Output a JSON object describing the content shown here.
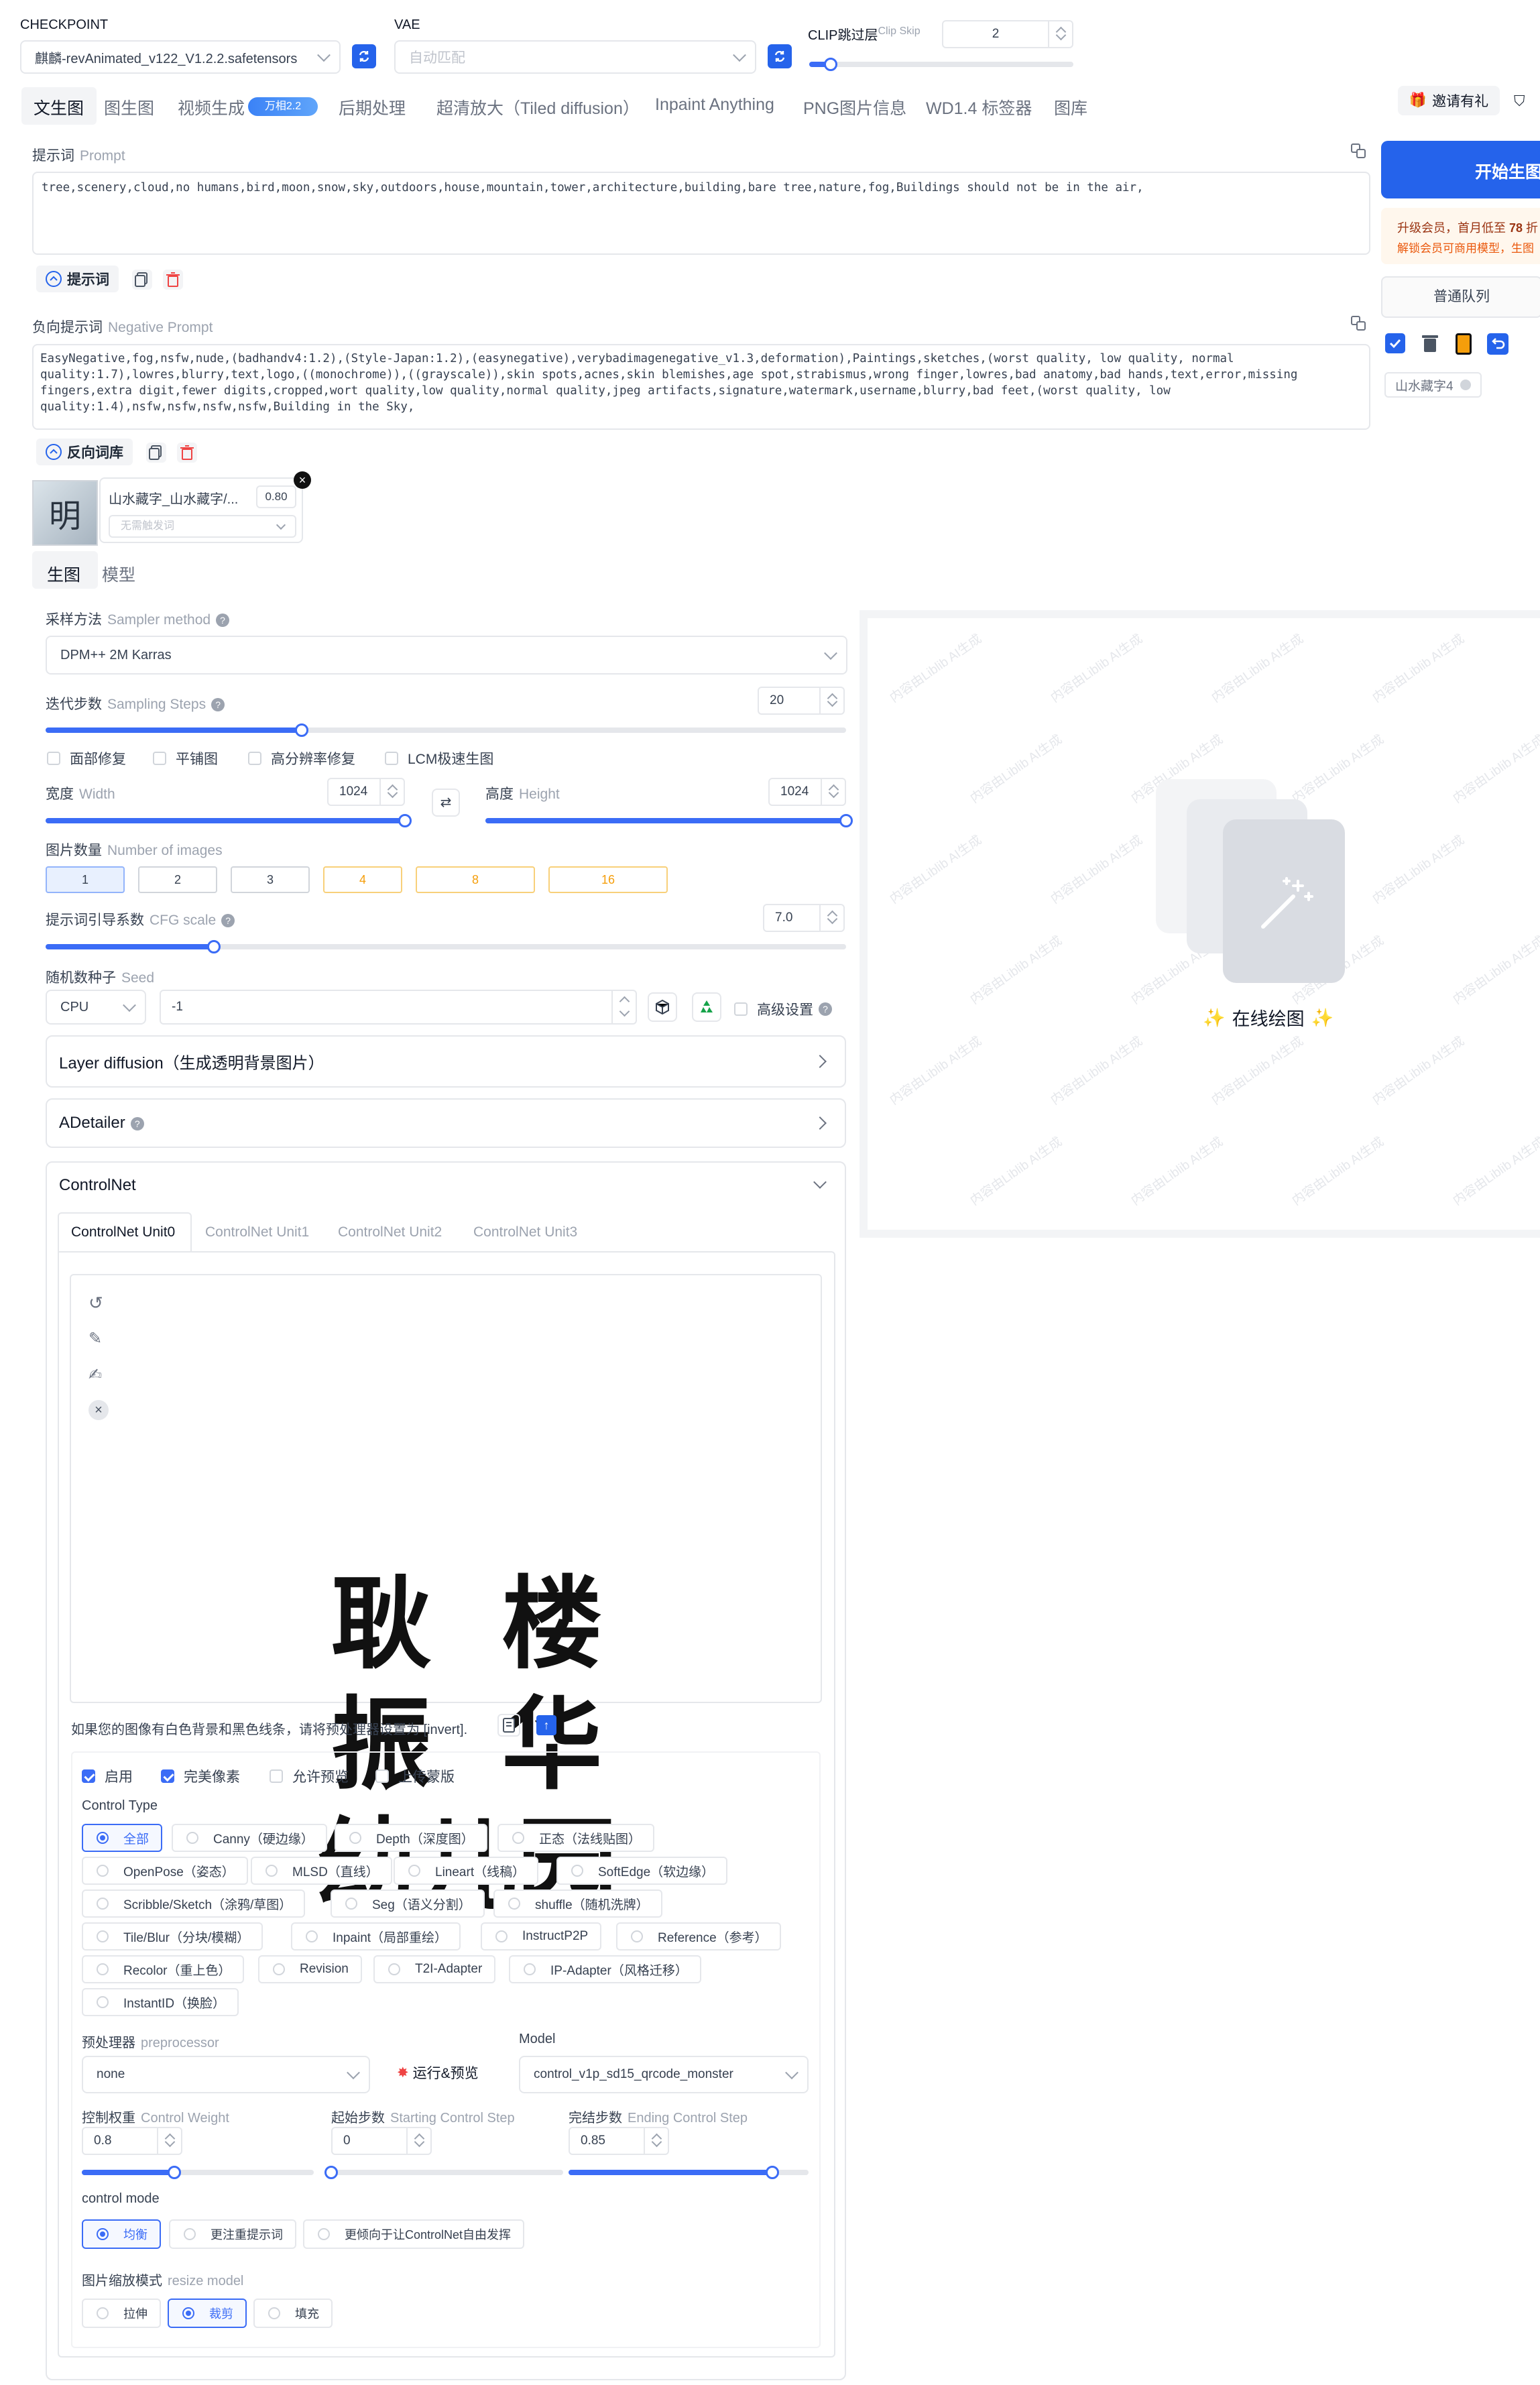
{
  "checkpoint": {
    "label": "CHECKPOINT",
    "value": "麒麟-revAnimated_v122_V1.2.2.safetensors"
  },
  "vae": {
    "label": "VAE",
    "placeholder": "自动匹配"
  },
  "clip": {
    "label": "CLIP跳过层",
    "sub": "Clip Skip",
    "value": "2",
    "level": 0.08
  },
  "tabs": [
    "文生图",
    "图生图",
    "视频生成",
    "后期处理",
    "超清放大（Tiled diffusion）",
    "Inpaint Anything",
    "PNG图片信息",
    "WD1.4 标签器",
    "图库"
  ],
  "video_badge": "万相2.2",
  "invite": "邀请有礼",
  "generate": "开始生图",
  "member": {
    "line1_a": "升级会员，首月低至 ",
    "line1_b": "78",
    "line1_c": " 折",
    "line2": "解锁会员可商用模型，生图"
  },
  "queue": "普通队列",
  "lora_chip": "山水藏字4",
  "prompt": {
    "label": "提示词",
    "sub": "Prompt",
    "text": "tree,scenery,cloud,no humans,bird,moon,snow,sky,outdoors,house,mountain,tower,architecture,building,bare tree,nature,fog,Buildings should not be in the air,",
    "lib": "提示词"
  },
  "negative": {
    "label": "负向提示词",
    "sub": "Negative Prompt",
    "text": "EasyNegative,fog,nsfw,nude,(badhandv4:1.2),(Style-Japan:1.2),(easynegative),verybadimagenegative_v1.3,deformation),Paintings,sketches,(worst quality, low quality, normal quality:1.7),lowres,blurry,text,logo,((monochrome)),((grayscale)),skin spots,acnes,skin blemishes,age spot,strabismus,wrong finger,lowres,bad anatomy,bad hands,text,error,missing fingers,extra digit,fewer digits,cropped,wort quality,low quality,normal quality,jpeg artifacts,signature,watermark,username,blurry,bad feet,(worst quality, low quality:1.4),nsfw,nsfw,nsfw,nsfw,Building in the Sky,",
    "lib": "反向词库"
  },
  "lora": {
    "name": "山水藏字_山水藏字/...",
    "weight": "0.80",
    "trigger": "无需触发词",
    "thumb_text": "明"
  },
  "subtabs": [
    "生图",
    "模型"
  ],
  "sampler": {
    "label": "采样方法",
    "sub": "Sampler method",
    "value": "DPM++ 2M Karras"
  },
  "steps": {
    "label": "迭代步数",
    "sub": "Sampling Steps",
    "value": "20",
    "level": 0.32
  },
  "options": [
    "面部修复",
    "平铺图",
    "高分辨率修复",
    "LCM极速生图"
  ],
  "width": {
    "label": "宽度",
    "sub": "Width",
    "value": "1024",
    "level": 1.0
  },
  "height": {
    "label": "高度",
    "sub": "Height",
    "value": "1024",
    "level": 1.0
  },
  "batch": {
    "label": "图片数量",
    "sub": "Number of images",
    "options": [
      "1",
      "2",
      "3",
      "4",
      "8",
      "16"
    ],
    "selected": "1"
  },
  "cfg": {
    "label": "提示词引导系数",
    "sub": "CFG scale",
    "value": "7.0",
    "level": 0.21
  },
  "seed": {
    "label": "随机数种子",
    "sub": "Seed",
    "device": "CPU",
    "value": "-1",
    "advanced": "高级设置"
  },
  "sections": {
    "layer": "Layer diffusion（生成透明背景图片）",
    "adetailer": "ADetailer",
    "controlnet": "ControlNet"
  },
  "cn_tabs": [
    "ControlNet Unit0",
    "ControlNet Unit1",
    "ControlNet Unit2",
    "ControlNet Unit3"
  ],
  "cn_image_text": [
    "耿  楼",
    "振  华",
    "幼儿园"
  ],
  "cn_hint": "如果您的图像有白色背景和黑色线条，请将预处理器设置为 [invert].",
  "cn_checks": [
    "启用",
    "完美像素",
    "允许预览",
    "上传蒙版"
  ],
  "control_type": {
    "label": "Control Type",
    "rows": [
      [
        "全部",
        "Canny（硬边缘）",
        "Depth（深度图）",
        "正态（法线贴图）"
      ],
      [
        "OpenPose（姿态）",
        "MLSD（直线）",
        "Lineart（线稿）",
        "SoftEdge（软边缘）"
      ],
      [
        "Scribble/Sketch（涂鸦/草图）",
        "Seg（语义分割）",
        "shuffle（随机洗牌）"
      ],
      [
        "Tile/Blur（分块/模糊）",
        "Inpaint（局部重绘）",
        "InstructP2P",
        "Reference（参考）"
      ],
      [
        "Recolor（重上色）",
        "Revision",
        "T2I-Adapter",
        "IP-Adapter（风格迁移）"
      ],
      [
        "InstantID（换脸）"
      ]
    ]
  },
  "preprocessor": {
    "label": "预处理器",
    "sub": "preprocessor",
    "value": "none",
    "run": "运行&预览"
  },
  "model": {
    "label": "Model",
    "value": "control_v1p_sd15_qrcode_monster"
  },
  "control_weight": {
    "label": "控制权重",
    "sub": "Control Weight",
    "value": "0.8",
    "level": 0.4
  },
  "start_step": {
    "label": "起始步数",
    "sub": "Starting Control Step",
    "value": "0",
    "level": 0.0
  },
  "end_step": {
    "label": "完结步数",
    "sub": "Ending Control Step",
    "value": "0.85",
    "level": 0.85
  },
  "control_mode": {
    "label": "control mode",
    "options": [
      "均衡",
      "更注重提示词",
      "更倾向于让ControlNet自由发挥"
    ]
  },
  "resize": {
    "label": "图片缩放模式",
    "sub": "resize model",
    "options": [
      "拉伸",
      "裁剪",
      "填充"
    ]
  },
  "canvas": {
    "online": "在线绘图",
    "watermark": "内容由Liblib AI生成"
  }
}
